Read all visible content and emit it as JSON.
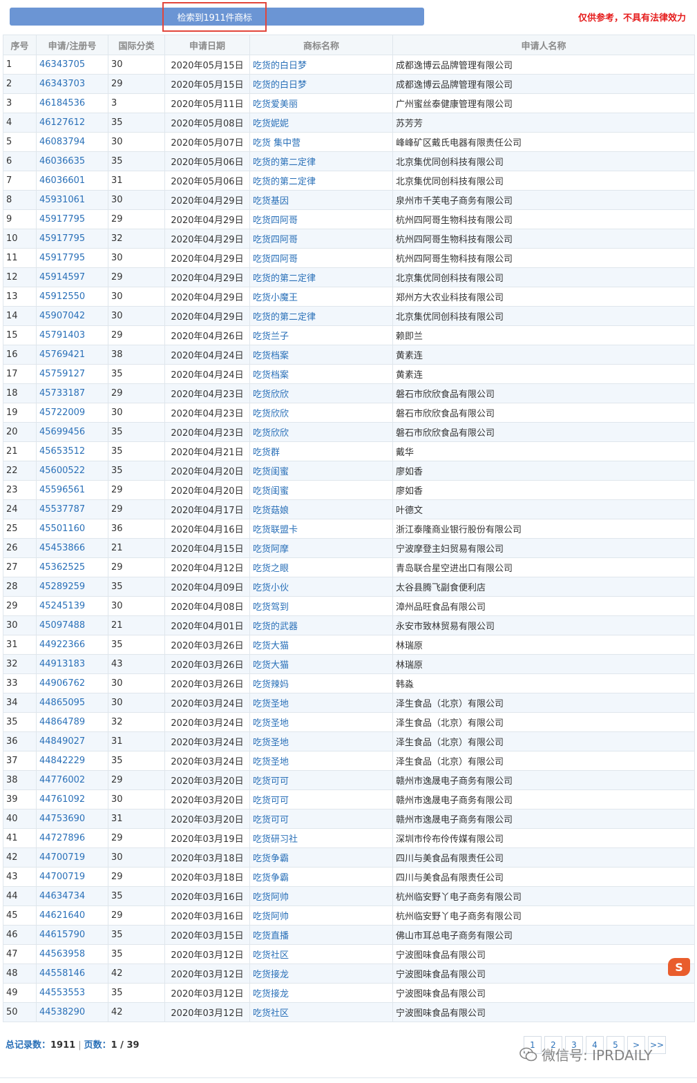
{
  "header": {
    "result_text": "检索到1911件商标",
    "disclaimer": "仅供参考，不具有法律效力"
  },
  "table": {
    "columns": [
      "序号",
      "申请/注册号",
      "国际分类",
      "申请日期",
      "商标名称",
      "申请人名称"
    ],
    "rows": [
      [
        "1",
        "46343705",
        "30",
        "2020年05月15日",
        "吃货的白日梦",
        "成都逸博云品牌管理有限公司"
      ],
      [
        "2",
        "46343703",
        "29",
        "2020年05月15日",
        "吃货的白日梦",
        "成都逸博云品牌管理有限公司"
      ],
      [
        "3",
        "46184536",
        "3",
        "2020年05月11日",
        "吃货爱美丽",
        "广州蜜丝泰健康管理有限公司"
      ],
      [
        "4",
        "46127612",
        "35",
        "2020年05月08日",
        "吃货妮妮",
        "苏芳芳"
      ],
      [
        "5",
        "46083794",
        "30",
        "2020年05月07日",
        "吃货 集中营",
        "峰峰矿区戴氏电器有限责任公司"
      ],
      [
        "6",
        "46036635",
        "35",
        "2020年05月06日",
        "吃货的第二定律",
        "北京集优同创科技有限公司"
      ],
      [
        "7",
        "46036601",
        "31",
        "2020年05月06日",
        "吃货的第二定律",
        "北京集优同创科技有限公司"
      ],
      [
        "8",
        "45931061",
        "30",
        "2020年04月29日",
        "吃货基因",
        "泉州市千芙电子商务有限公司"
      ],
      [
        "9",
        "45917795",
        "29",
        "2020年04月29日",
        "吃货四阿哥",
        "杭州四阿哥生物科技有限公司"
      ],
      [
        "10",
        "45917795",
        "32",
        "2020年04月29日",
        "吃货四阿哥",
        "杭州四阿哥生物科技有限公司"
      ],
      [
        "11",
        "45917795",
        "30",
        "2020年04月29日",
        "吃货四阿哥",
        "杭州四阿哥生物科技有限公司"
      ],
      [
        "12",
        "45914597",
        "29",
        "2020年04月29日",
        "吃货的第二定律",
        "北京集优同创科技有限公司"
      ],
      [
        "13",
        "45912550",
        "30",
        "2020年04月29日",
        "吃货小魔王",
        "郑州方大农业科技有限公司"
      ],
      [
        "14",
        "45907042",
        "30",
        "2020年04月29日",
        "吃货的第二定律",
        "北京集优同创科技有限公司"
      ],
      [
        "15",
        "45791403",
        "29",
        "2020年04月26日",
        "吃货兰子",
        "赖即兰"
      ],
      [
        "16",
        "45769421",
        "38",
        "2020年04月24日",
        "吃货档案",
        "黄素连"
      ],
      [
        "17",
        "45759127",
        "35",
        "2020年04月24日",
        "吃货档案",
        "黄素连"
      ],
      [
        "18",
        "45733187",
        "29",
        "2020年04月23日",
        "吃货欣欣",
        "磐石市欣欣食品有限公司"
      ],
      [
        "19",
        "45722009",
        "30",
        "2020年04月23日",
        "吃货欣欣",
        "磐石市欣欣食品有限公司"
      ],
      [
        "20",
        "45699456",
        "35",
        "2020年04月23日",
        "吃货欣欣",
        "磐石市欣欣食品有限公司"
      ],
      [
        "21",
        "45653512",
        "35",
        "2020年04月21日",
        "吃货群",
        "戴华"
      ],
      [
        "22",
        "45600522",
        "35",
        "2020年04月20日",
        "吃货闺蜜",
        "廖如香"
      ],
      [
        "23",
        "45596561",
        "29",
        "2020年04月20日",
        "吃货闺蜜",
        "廖如香"
      ],
      [
        "24",
        "45537787",
        "29",
        "2020年04月17日",
        "吃货菇娘",
        "叶德文"
      ],
      [
        "25",
        "45501160",
        "36",
        "2020年04月16日",
        "吃货联盟卡",
        "浙江泰隆商业银行股份有限公司"
      ],
      [
        "26",
        "45453866",
        "21",
        "2020年04月15日",
        "吃货阿摩",
        "宁波摩登主妇贸易有限公司"
      ],
      [
        "27",
        "45362525",
        "29",
        "2020年04月12日",
        "吃货之眼",
        "青岛联合星空进出口有限公司"
      ],
      [
        "28",
        "45289259",
        "35",
        "2020年04月09日",
        "吃货小伙",
        "太谷县腾飞副食便利店"
      ],
      [
        "29",
        "45245139",
        "30",
        "2020年04月08日",
        "吃货驾到",
        "漳州品旺食品有限公司"
      ],
      [
        "30",
        "45097488",
        "21",
        "2020年04月01日",
        "吃货的武器",
        "永安市致林贸易有限公司"
      ],
      [
        "31",
        "44922366",
        "35",
        "2020年03月26日",
        "吃货大猫",
        "林瑞原"
      ],
      [
        "32",
        "44913183",
        "43",
        "2020年03月26日",
        "吃货大猫",
        "林瑞原"
      ],
      [
        "33",
        "44906762",
        "30",
        "2020年03月26日",
        "吃货辣妈",
        "韩淼"
      ],
      [
        "34",
        "44865095",
        "30",
        "2020年03月24日",
        "吃货圣地",
        "泽生食品（北京）有限公司"
      ],
      [
        "35",
        "44864789",
        "32",
        "2020年03月24日",
        "吃货圣地",
        "泽生食品（北京）有限公司"
      ],
      [
        "36",
        "44849027",
        "31",
        "2020年03月24日",
        "吃货圣地",
        "泽生食品（北京）有限公司"
      ],
      [
        "37",
        "44842229",
        "35",
        "2020年03月24日",
        "吃货圣地",
        "泽生食品（北京）有限公司"
      ],
      [
        "38",
        "44776002",
        "29",
        "2020年03月20日",
        "吃货可可",
        "赣州市逸晟电子商务有限公司"
      ],
      [
        "39",
        "44761092",
        "30",
        "2020年03月20日",
        "吃货可可",
        "赣州市逸晟电子商务有限公司"
      ],
      [
        "40",
        "44753690",
        "31",
        "2020年03月20日",
        "吃货可可",
        "赣州市逸晟电子商务有限公司"
      ],
      [
        "41",
        "44727896",
        "29",
        "2020年03月19日",
        "吃货研习社",
        "深圳市伶布伶传媒有限公司"
      ],
      [
        "42",
        "44700719",
        "30",
        "2020年03月18日",
        "吃货争霸",
        "四川与美食品有限责任公司"
      ],
      [
        "43",
        "44700719",
        "29",
        "2020年03月18日",
        "吃货争霸",
        "四川与美食品有限责任公司"
      ],
      [
        "44",
        "44634734",
        "35",
        "2020年03月16日",
        "吃货阿帅",
        "杭州临安野丫电子商务有限公司"
      ],
      [
        "45",
        "44621640",
        "29",
        "2020年03月16日",
        "吃货阿帅",
        "杭州临安野丫电子商务有限公司"
      ],
      [
        "46",
        "44615790",
        "35",
        "2020年03月15日",
        "吃货直播",
        "佛山市耳总电子商务有限公司"
      ],
      [
        "47",
        "44563958",
        "35",
        "2020年03月12日",
        "吃货社区",
        "宁波图味食品有限公司"
      ],
      [
        "48",
        "44558146",
        "42",
        "2020年03月12日",
        "吃货接龙",
        "宁波图味食品有限公司"
      ],
      [
        "49",
        "44553553",
        "35",
        "2020年03月12日",
        "吃货接龙",
        "宁波图味食品有限公司"
      ],
      [
        "50",
        "44538290",
        "42",
        "2020年03月12日",
        "吃货社区",
        "宁波图味食品有限公司"
      ]
    ]
  },
  "footer": {
    "total_label": "总记录数：",
    "total_value": "1911",
    "separator": "|",
    "pages_label": "页数：",
    "pages_value": "1 / 39"
  },
  "pagination": [
    "1",
    "2",
    "3",
    "4",
    "5",
    ">",
    ">>"
  ],
  "watermark": {
    "text": "微信号: IPRDAILY",
    "icon": "wechat-icon"
  },
  "ime": {
    "icon": "sogou-ime-icon",
    "glyph": "S"
  },
  "colors": {
    "topbar": "#6b95d4",
    "highlight_border": "#e2453a",
    "disclaimer": "#e51c1c",
    "link": "#2a70b8",
    "row_alt": "#f2f7fc"
  }
}
